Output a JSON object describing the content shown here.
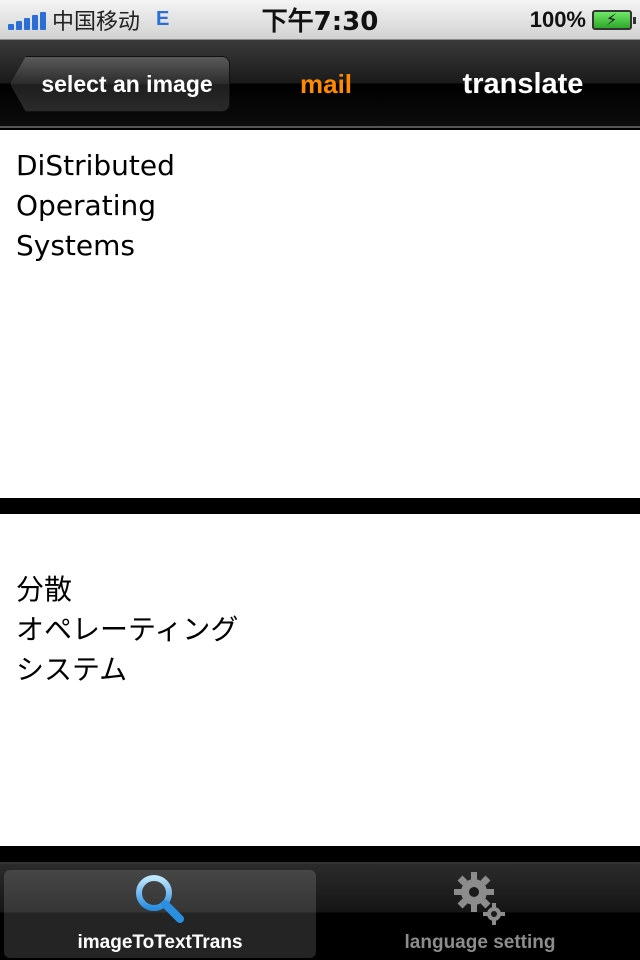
{
  "status_bar": {
    "carrier": "中国移动",
    "network": "E",
    "time": "下午7:30",
    "battery": "100%",
    "signal_icon": "signal-bars-icon",
    "battery_icon": "battery-charging-icon"
  },
  "nav": {
    "back_label": "select an image",
    "mail_label": "mail",
    "translate_label": "translate",
    "mail_color": "#ff8a00"
  },
  "source_text": {
    "lines": [
      "DiStributed",
      "Operating",
      "Systems"
    ]
  },
  "translated_text": {
    "lines": [
      "分散",
      "オペレーティング",
      "システム"
    ]
  },
  "tabs": [
    {
      "label": "imageToTextTrans",
      "icon": "search-icon",
      "selected": true
    },
    {
      "label": "language setting",
      "icon": "gear-icon",
      "selected": false
    }
  ]
}
